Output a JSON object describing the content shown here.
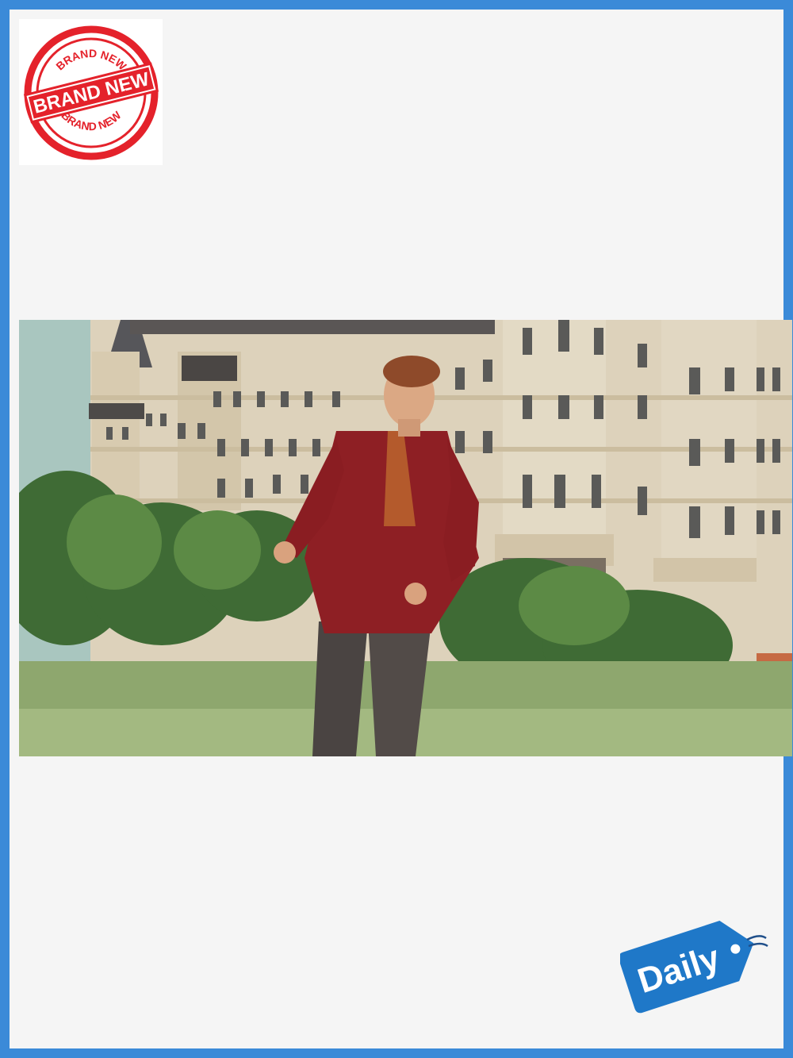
{
  "badge": {
    "top_text": "BRAND NEW",
    "banner_text": "BRAND NEW",
    "bottom_text": "BRAND NEW",
    "color": "#e4222b"
  },
  "tag": {
    "label": "Daily",
    "color": "#1f78c8"
  },
  "photo": {
    "icon": "photo-person-walking-red-cardigan"
  },
  "colors": {
    "frame": "#3b8ad8",
    "background": "#f5f5f5"
  }
}
